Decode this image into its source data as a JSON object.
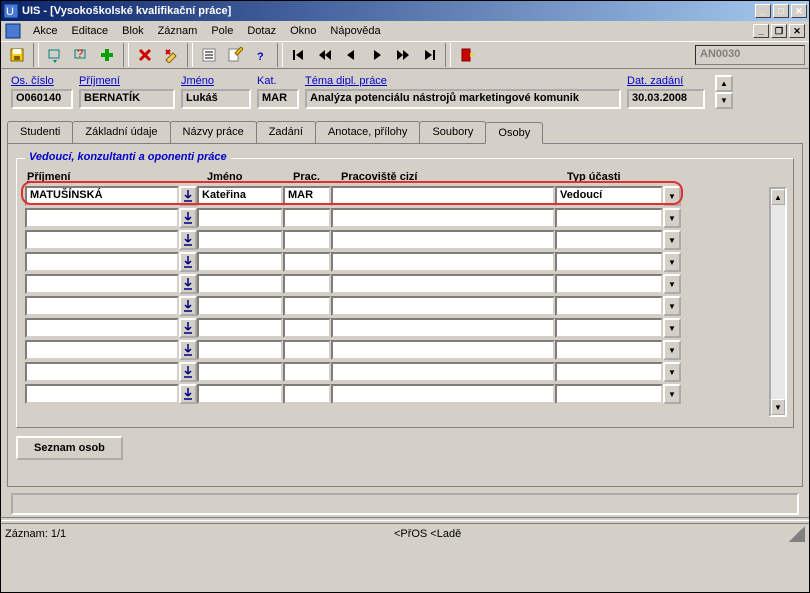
{
  "window": {
    "title": "UIS - [Vysokoškolské kvalifikační práce]"
  },
  "menu": {
    "items": [
      "Akce",
      "Editace",
      "Blok",
      "Záznam",
      "Pole",
      "Dotaz",
      "Okno",
      "Nápověda"
    ]
  },
  "toolbar": {
    "code": "AN0030"
  },
  "header": {
    "os_cislo_label": "Os. číslo",
    "os_cislo": "O060140",
    "prijmeni_label": "Příjmení",
    "prijmeni": "BERNATÍK",
    "jmeno_label": "Jméno",
    "jmeno": "Lukáš",
    "kat_label": "Kat.",
    "kat": "MAR",
    "tema_label": "Téma dipl. práce",
    "tema": "Analýza potenciálu nástrojů marketingové komunik",
    "dat_label": "Dat. zadání",
    "dat": "30.03.2008"
  },
  "tabs": {
    "items": [
      "Studenti",
      "Základní údaje",
      "Názvy práce",
      "Zadání",
      "Anotace, přílohy",
      "Soubory",
      "Osoby"
    ],
    "active": 6
  },
  "group": {
    "title": "Vedoucí, konzultanti a oponenti práce",
    "columns": {
      "prijmeni": "Příjmení",
      "jmeno": "Jméno",
      "prac": "Prac.",
      "pracoviste_cizi": "Pracoviště cizí",
      "typ_ucasti": "Typ účasti"
    },
    "rows": [
      {
        "prijmeni": "MATUŠÍNSKÁ",
        "jmeno": "Kateřina",
        "prac": "MAR",
        "pracoviste_cizi": "",
        "typ_ucasti": "Vedoucí"
      },
      {
        "prijmeni": "",
        "jmeno": "",
        "prac": "",
        "pracoviste_cizi": "",
        "typ_ucasti": ""
      },
      {
        "prijmeni": "",
        "jmeno": "",
        "prac": "",
        "pracoviste_cizi": "",
        "typ_ucasti": ""
      },
      {
        "prijmeni": "",
        "jmeno": "",
        "prac": "",
        "pracoviste_cizi": "",
        "typ_ucasti": ""
      },
      {
        "prijmeni": "",
        "jmeno": "",
        "prac": "",
        "pracoviste_cizi": "",
        "typ_ucasti": ""
      },
      {
        "prijmeni": "",
        "jmeno": "",
        "prac": "",
        "pracoviste_cizi": "",
        "typ_ucasti": ""
      },
      {
        "prijmeni": "",
        "jmeno": "",
        "prac": "",
        "pracoviste_cizi": "",
        "typ_ucasti": ""
      },
      {
        "prijmeni": "",
        "jmeno": "",
        "prac": "",
        "pracoviste_cizi": "",
        "typ_ucasti": ""
      },
      {
        "prijmeni": "",
        "jmeno": "",
        "prac": "",
        "pracoviste_cizi": "",
        "typ_ucasti": ""
      },
      {
        "prijmeni": "",
        "jmeno": "",
        "prac": "",
        "pracoviste_cizi": "",
        "typ_ucasti": ""
      }
    ]
  },
  "buttons": {
    "seznam_osob": "Seznam osob"
  },
  "status": {
    "record": "Záznam: 1/1",
    "mid": "<PřOS  <Ladě"
  }
}
